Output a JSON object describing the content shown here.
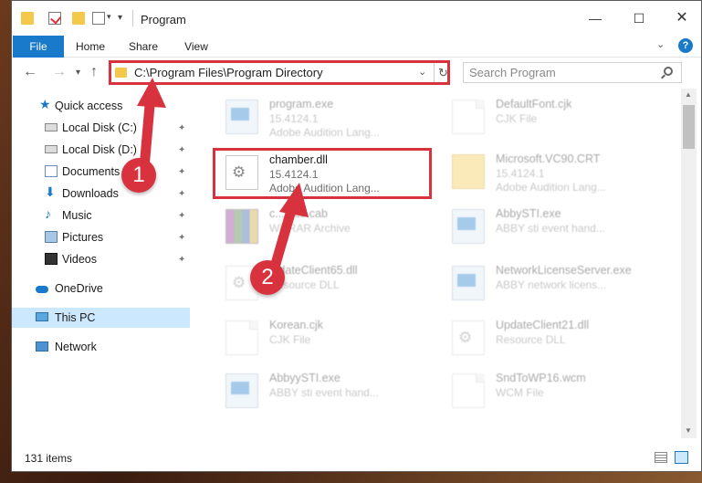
{
  "window": {
    "title": "Program",
    "minimize_glyph": "—",
    "maximize_glyph": "☐",
    "close_glyph": "✕"
  },
  "quick_access_toolbar": {
    "icons": [
      "folder-icon",
      "properties-icon",
      "new-folder-icon",
      "view-icon"
    ],
    "dropdown_glyph": "▾"
  },
  "ribbon": {
    "tabs": [
      "File",
      "Home",
      "Share",
      "View"
    ],
    "expand_glyph": "⌄",
    "help_glyph": "?"
  },
  "navigation": {
    "back_glyph": "←",
    "forward_glyph": "→",
    "recent_glyph": "▾",
    "up_glyph": "↑",
    "address": "C:\\Program Files\\Program Directory",
    "address_dropdown_glyph": "⌄",
    "refresh_glyph": "↻",
    "search_placeholder": "Search Program"
  },
  "sidebar": {
    "items": [
      {
        "label": "Quick access",
        "icon": "star-icon",
        "pinned": false
      },
      {
        "label": "Local Disk (C:)",
        "icon": "disk-icon",
        "pinned": true
      },
      {
        "label": "Local Disk (D:)",
        "icon": "disk-icon",
        "pinned": true
      },
      {
        "label": "Documents",
        "icon": "documents-icon",
        "pinned": true
      },
      {
        "label": "Downloads",
        "icon": "downloads-icon",
        "pinned": true
      },
      {
        "label": "Music",
        "icon": "music-icon",
        "pinned": true
      },
      {
        "label": "Pictures",
        "icon": "pictures-icon",
        "pinned": true
      },
      {
        "label": "Videos",
        "icon": "videos-icon",
        "pinned": true
      },
      {
        "label": "OneDrive",
        "icon": "onedrive-icon",
        "pinned": false
      },
      {
        "label": "This PC",
        "icon": "this-pc-icon",
        "pinned": false,
        "selected": true
      },
      {
        "label": "Network",
        "icon": "network-icon",
        "pinned": false
      }
    ],
    "pin_glyph": "📌"
  },
  "files": [
    {
      "name": "program.exe",
      "meta1": "15.4124.1",
      "meta2": "Adobe Audition Lang...",
      "icon": "exe-icon",
      "faded": true
    },
    {
      "name": "DefaultFont.cjk",
      "meta1": "CJK File",
      "meta2": "",
      "icon": "document-icon",
      "faded": true
    },
    {
      "name": "chamber.dll",
      "meta1": "15.4124.1",
      "meta2": "Adobe Audition Lang...",
      "icon": "dll-gear-icon",
      "faded": false,
      "highlighted": true
    },
    {
      "name": "Microsoft.VC90.CRT",
      "meta1": "15.4124.1",
      "meta2": "Adobe Audition Lang...",
      "icon": "folder-zip-icon",
      "faded": true
    },
    {
      "name": "c...ates.cab",
      "meta1": "WinRAR Archive",
      "meta2": "",
      "icon": "cab-icon",
      "faded": true
    },
    {
      "name": "AbbySTI.exe",
      "meta1": "ABBY sti event hand...",
      "meta2": "",
      "icon": "exe-icon",
      "faded": true
    },
    {
      "name": "...dateClient65.dll",
      "meta1": "Resource DLL",
      "meta2": "",
      "icon": "dll-gear-icon",
      "faded": true
    },
    {
      "name": "NetworkLicenseServer.exe",
      "meta1": "ABBY network licens...",
      "meta2": "",
      "icon": "exe-icon",
      "faded": true
    },
    {
      "name": "Korean.cjk",
      "meta1": "CJK File",
      "meta2": "",
      "icon": "document-icon",
      "faded": true
    },
    {
      "name": "UpdateClient21.dll",
      "meta1": "Resource DLL",
      "meta2": "",
      "icon": "dll-gear-icon",
      "faded": true
    },
    {
      "name": "AbbyySTI.exe",
      "meta1": "ABBY sti event hand...",
      "meta2": "",
      "icon": "exe-icon",
      "faded": true
    },
    {
      "name": "SndToWP16.wcm",
      "meta1": "WCM File",
      "meta2": "",
      "icon": "document-icon",
      "faded": true
    }
  ],
  "status": {
    "item_count": "131 items"
  },
  "annotations": {
    "step1": "1",
    "step2": "2",
    "color": "#d9323f"
  },
  "colors": {
    "accent": "#1979ca",
    "highlight_border": "#d9323f",
    "selected_bg": "#cce8ff"
  }
}
